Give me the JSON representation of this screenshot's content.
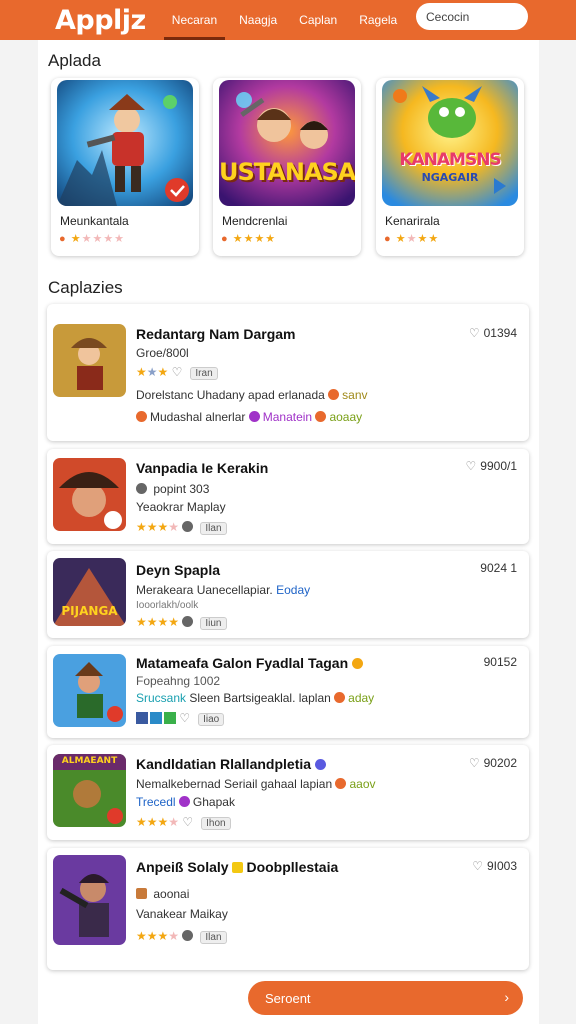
{
  "app": {
    "logo": "Appljz"
  },
  "nav": {
    "tabs": [
      {
        "label": "Necaran"
      },
      {
        "label": "Naagja"
      },
      {
        "label": "Caplan"
      },
      {
        "label": "Ragela"
      }
    ]
  },
  "search": {
    "value": "Cecocin"
  },
  "featured": {
    "title": "Aplada",
    "items": [
      {
        "name": "Meunkantala",
        "rating": 1
      },
      {
        "name": "Mendcrenlai",
        "rating": 4,
        "art_text": "USTANASA"
      },
      {
        "name": "Kenarirala",
        "rating": 3,
        "art_text": "KANAMSNS",
        "art_sub": "NGAGAIR"
      }
    ]
  },
  "list": {
    "title": "Caplazies",
    "items": [
      {
        "title": "Redantarg Nam Dargam",
        "count": "01394",
        "line1": "Groe/800l",
        "chip": "Iran",
        "line2": "Dorelstanc Uhadany apad erlanada",
        "line2_tag": "sanv",
        "line3": "Mudashal alnerlar",
        "line3_tag": "Manatein",
        "line3_tag2": "aoaay",
        "rating": 2
      },
      {
        "title": "Vanpadia Ie Kerakin",
        "count": "9900/1",
        "line1": "popint 303",
        "line2": "Yeaokrar Maplay",
        "chip": "Ilan",
        "rating": 3
      },
      {
        "title": "Deyn Spapla",
        "count": "9024 1",
        "line1": "Merakeara Uanecellapiar.",
        "line1_tag": "Eoday",
        "line2": "Iooorlakh/oolk",
        "chip": "Iiun",
        "rating": 4,
        "art_text": "PIJANGA"
      },
      {
        "title": "Matameafa Galon Fyadlal Tagan",
        "count": "90152",
        "line1": "Fopeahng 1002",
        "line2": "Srucsank",
        "line2b": "Sleen Bartsigeaklal. laplan",
        "line2_tag": "aday",
        "chip": "Iiao",
        "rating": 0
      },
      {
        "title": "Kandldatian Rlallandpletia",
        "count": "90202",
        "line1": "Nemalkebernad Seriail gahaal lapian",
        "line1_tag": "aaov",
        "line2": "Trecedl",
        "line2b": "Ghapak",
        "chip": "Ihon",
        "rating": 3,
        "art_text": "ALMAEANT"
      },
      {
        "title": "Anpeiß Solaly",
        "title_b": "Doobpllestaia",
        "count": "9I003",
        "line1": "aoonai",
        "line2": "Vanakear Maikay",
        "chip": "Ilan",
        "rating": 3
      }
    ]
  },
  "cta": {
    "label": "Seroent",
    "arrow": "›"
  },
  "colors": {
    "brand": "#e8692d",
    "star": "#f3a712",
    "link": "#1e63c7",
    "tag": "#a032c8",
    "green_tag": "#7aa018"
  }
}
